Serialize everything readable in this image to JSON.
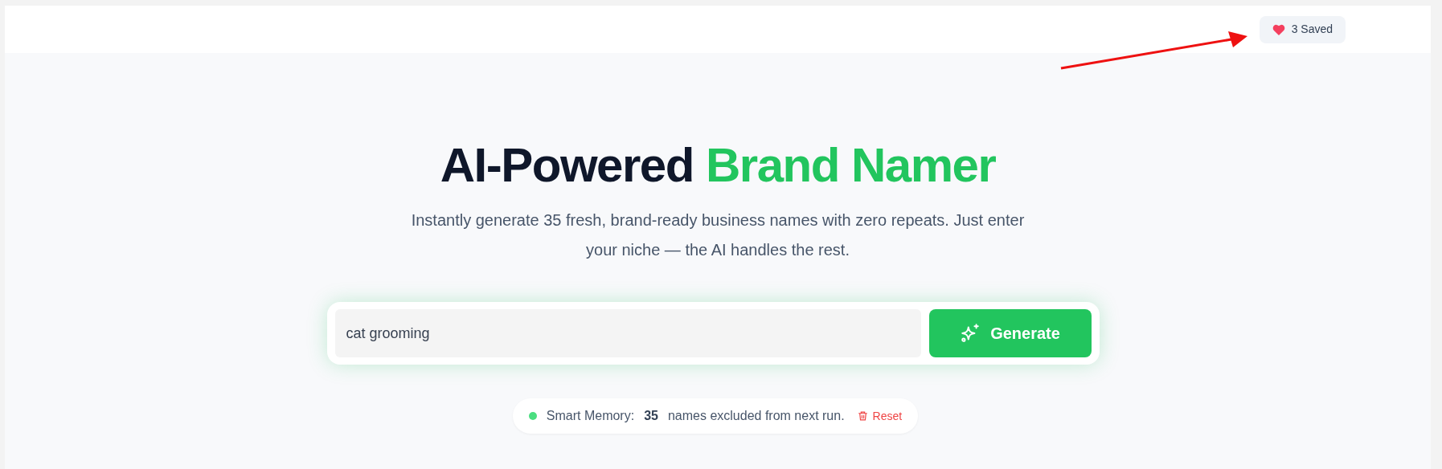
{
  "header": {
    "saved_button": {
      "label": "3 Saved"
    }
  },
  "hero": {
    "title": [
      {
        "text": "AI-Powered ",
        "kind": "plain"
      },
      {
        "text": "Brand Namer",
        "kind": "accent"
      }
    ],
    "subtitle": "Instantly generate 35 fresh, brand-ready business names with zero repeats. Just enter your niche — the AI handles the rest."
  },
  "search": {
    "value": "cat grooming",
    "button": "Generate"
  },
  "memory": {
    "label": "Smart Memory:",
    "count": "35",
    "text": "names excluded from next run.",
    "reset": "Reset"
  }
}
